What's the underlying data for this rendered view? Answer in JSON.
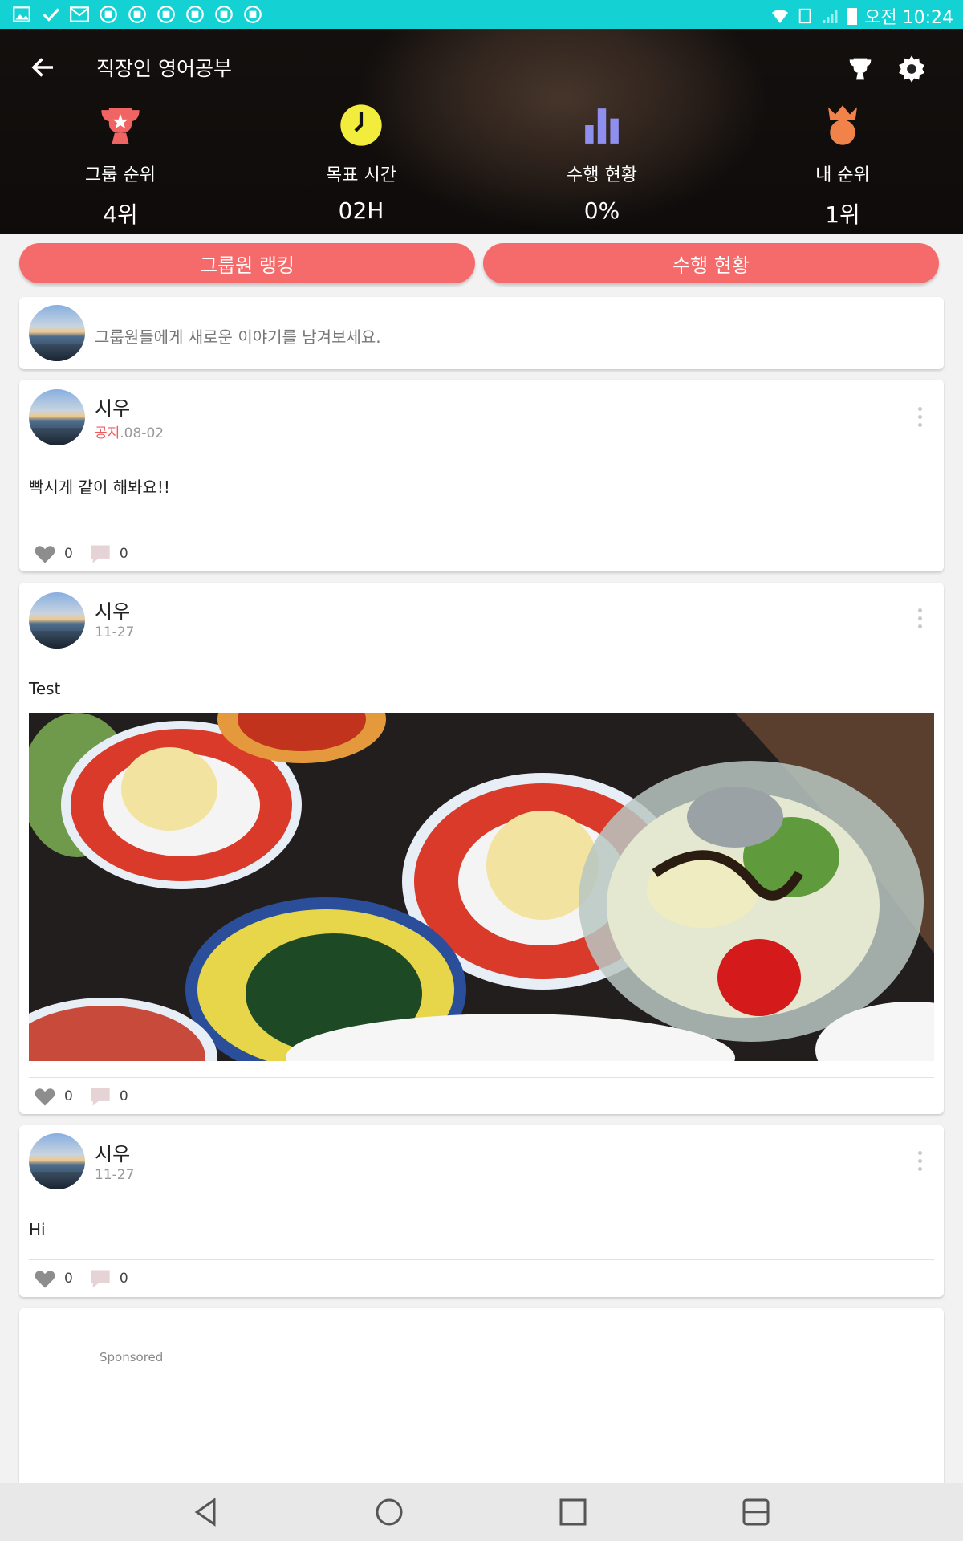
{
  "status_bar": {
    "time": "오전 10:24"
  },
  "header": {
    "title": "직장인 영어공부",
    "stats": [
      {
        "label": "그룹 순위",
        "value": "4위",
        "icon": "trophy-icon",
        "color": "#f06464"
      },
      {
        "label": "목표 시간",
        "value": "02H",
        "icon": "clock-icon",
        "color": "#f2ec3c"
      },
      {
        "label": "수행 현황",
        "value": "0%",
        "icon": "bar-chart-icon",
        "color": "#8f8ff0"
      },
      {
        "label": "내 순위",
        "value": "1위",
        "icon": "crown-medal-icon",
        "color": "#f0824a"
      }
    ]
  },
  "actions": {
    "ranking_label": "그룹원 랭킹",
    "progress_label": "수행 현황"
  },
  "compose": {
    "placeholder": "그룹원들에게 새로운 이야기를 남겨보세요."
  },
  "posts": [
    {
      "author": "시우",
      "notice": "공지",
      "date": ".08-02",
      "text": "빡시게 같이 해봐요!!",
      "likes": "0",
      "comments": "0"
    },
    {
      "author": "시우",
      "date": "11-27",
      "text": "Test",
      "likes": "0",
      "comments": "0"
    },
    {
      "author": "시우",
      "date": "11-27",
      "text": "Hi",
      "likes": "0",
      "comments": "0"
    }
  ],
  "ad": {
    "label": "Sponsored"
  },
  "colors": {
    "accent": "#f56b6b",
    "status_bar": "#14d1d4"
  }
}
